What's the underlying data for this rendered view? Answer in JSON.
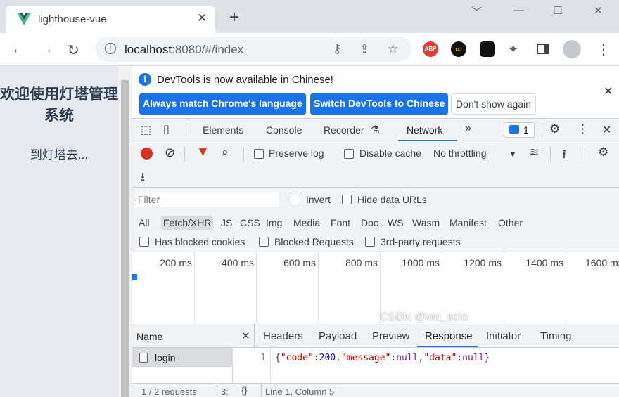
{
  "browser": {
    "tab_title": "lighthouse-vue",
    "url_host": "localhost",
    "url_rest": ":8080/#/index",
    "extensions": [
      "ABP",
      "∞"
    ]
  },
  "page": {
    "heading": "欢迎使用灯塔管理系统",
    "link": "到灯塔去..."
  },
  "devtools": {
    "infobar": {
      "message": "DevTools is now available in Chinese!",
      "btn_match": "Always match Chrome's language",
      "btn_switch": "Switch DevTools to Chinese",
      "btn_dont": "Don't show again"
    },
    "tabs": [
      "Elements",
      "Console",
      "Recorder",
      "Network"
    ],
    "issues_count": "1",
    "network": {
      "preserve_log": "Preserve log",
      "disable_cache": "Disable cache",
      "throttling": "No throttling",
      "filter_placeholder": "Filter",
      "invert": "Invert",
      "hide_data_urls": "Hide data URLs",
      "types": [
        "All",
        "Fetch/XHR",
        "JS",
        "CSS",
        "Img",
        "Media",
        "Font",
        "Doc",
        "WS",
        "Wasm",
        "Manifest",
        "Other"
      ],
      "has_blocked_cookies": "Has blocked cookies",
      "blocked_requests": "Blocked Requests",
      "third_party": "3rd-party requests",
      "ticks": [
        "200 ms",
        "400 ms",
        "600 ms",
        "800 ms",
        "1000 ms",
        "1200 ms",
        "1400 ms",
        "1600 ms"
      ],
      "name_header": "Name",
      "request_name": "login",
      "status_requests": "1 / 2 requests",
      "status_extra": "3:",
      "detail_tabs": [
        "Headers",
        "Payload",
        "Preview",
        "Response",
        "Initiator",
        "Timing"
      ],
      "line_number": "1",
      "response": {
        "code_key": "\"code\"",
        "code_val": "200",
        "message_key": "\"message\"",
        "data_key": "\"data\"",
        "null": "null"
      },
      "cursor_pos": "Line 1, Column 5"
    }
  },
  "watermark": "CSDN @wu_solo",
  "colors": {
    "accent": "#1a73e8",
    "record": "#d93025"
  }
}
